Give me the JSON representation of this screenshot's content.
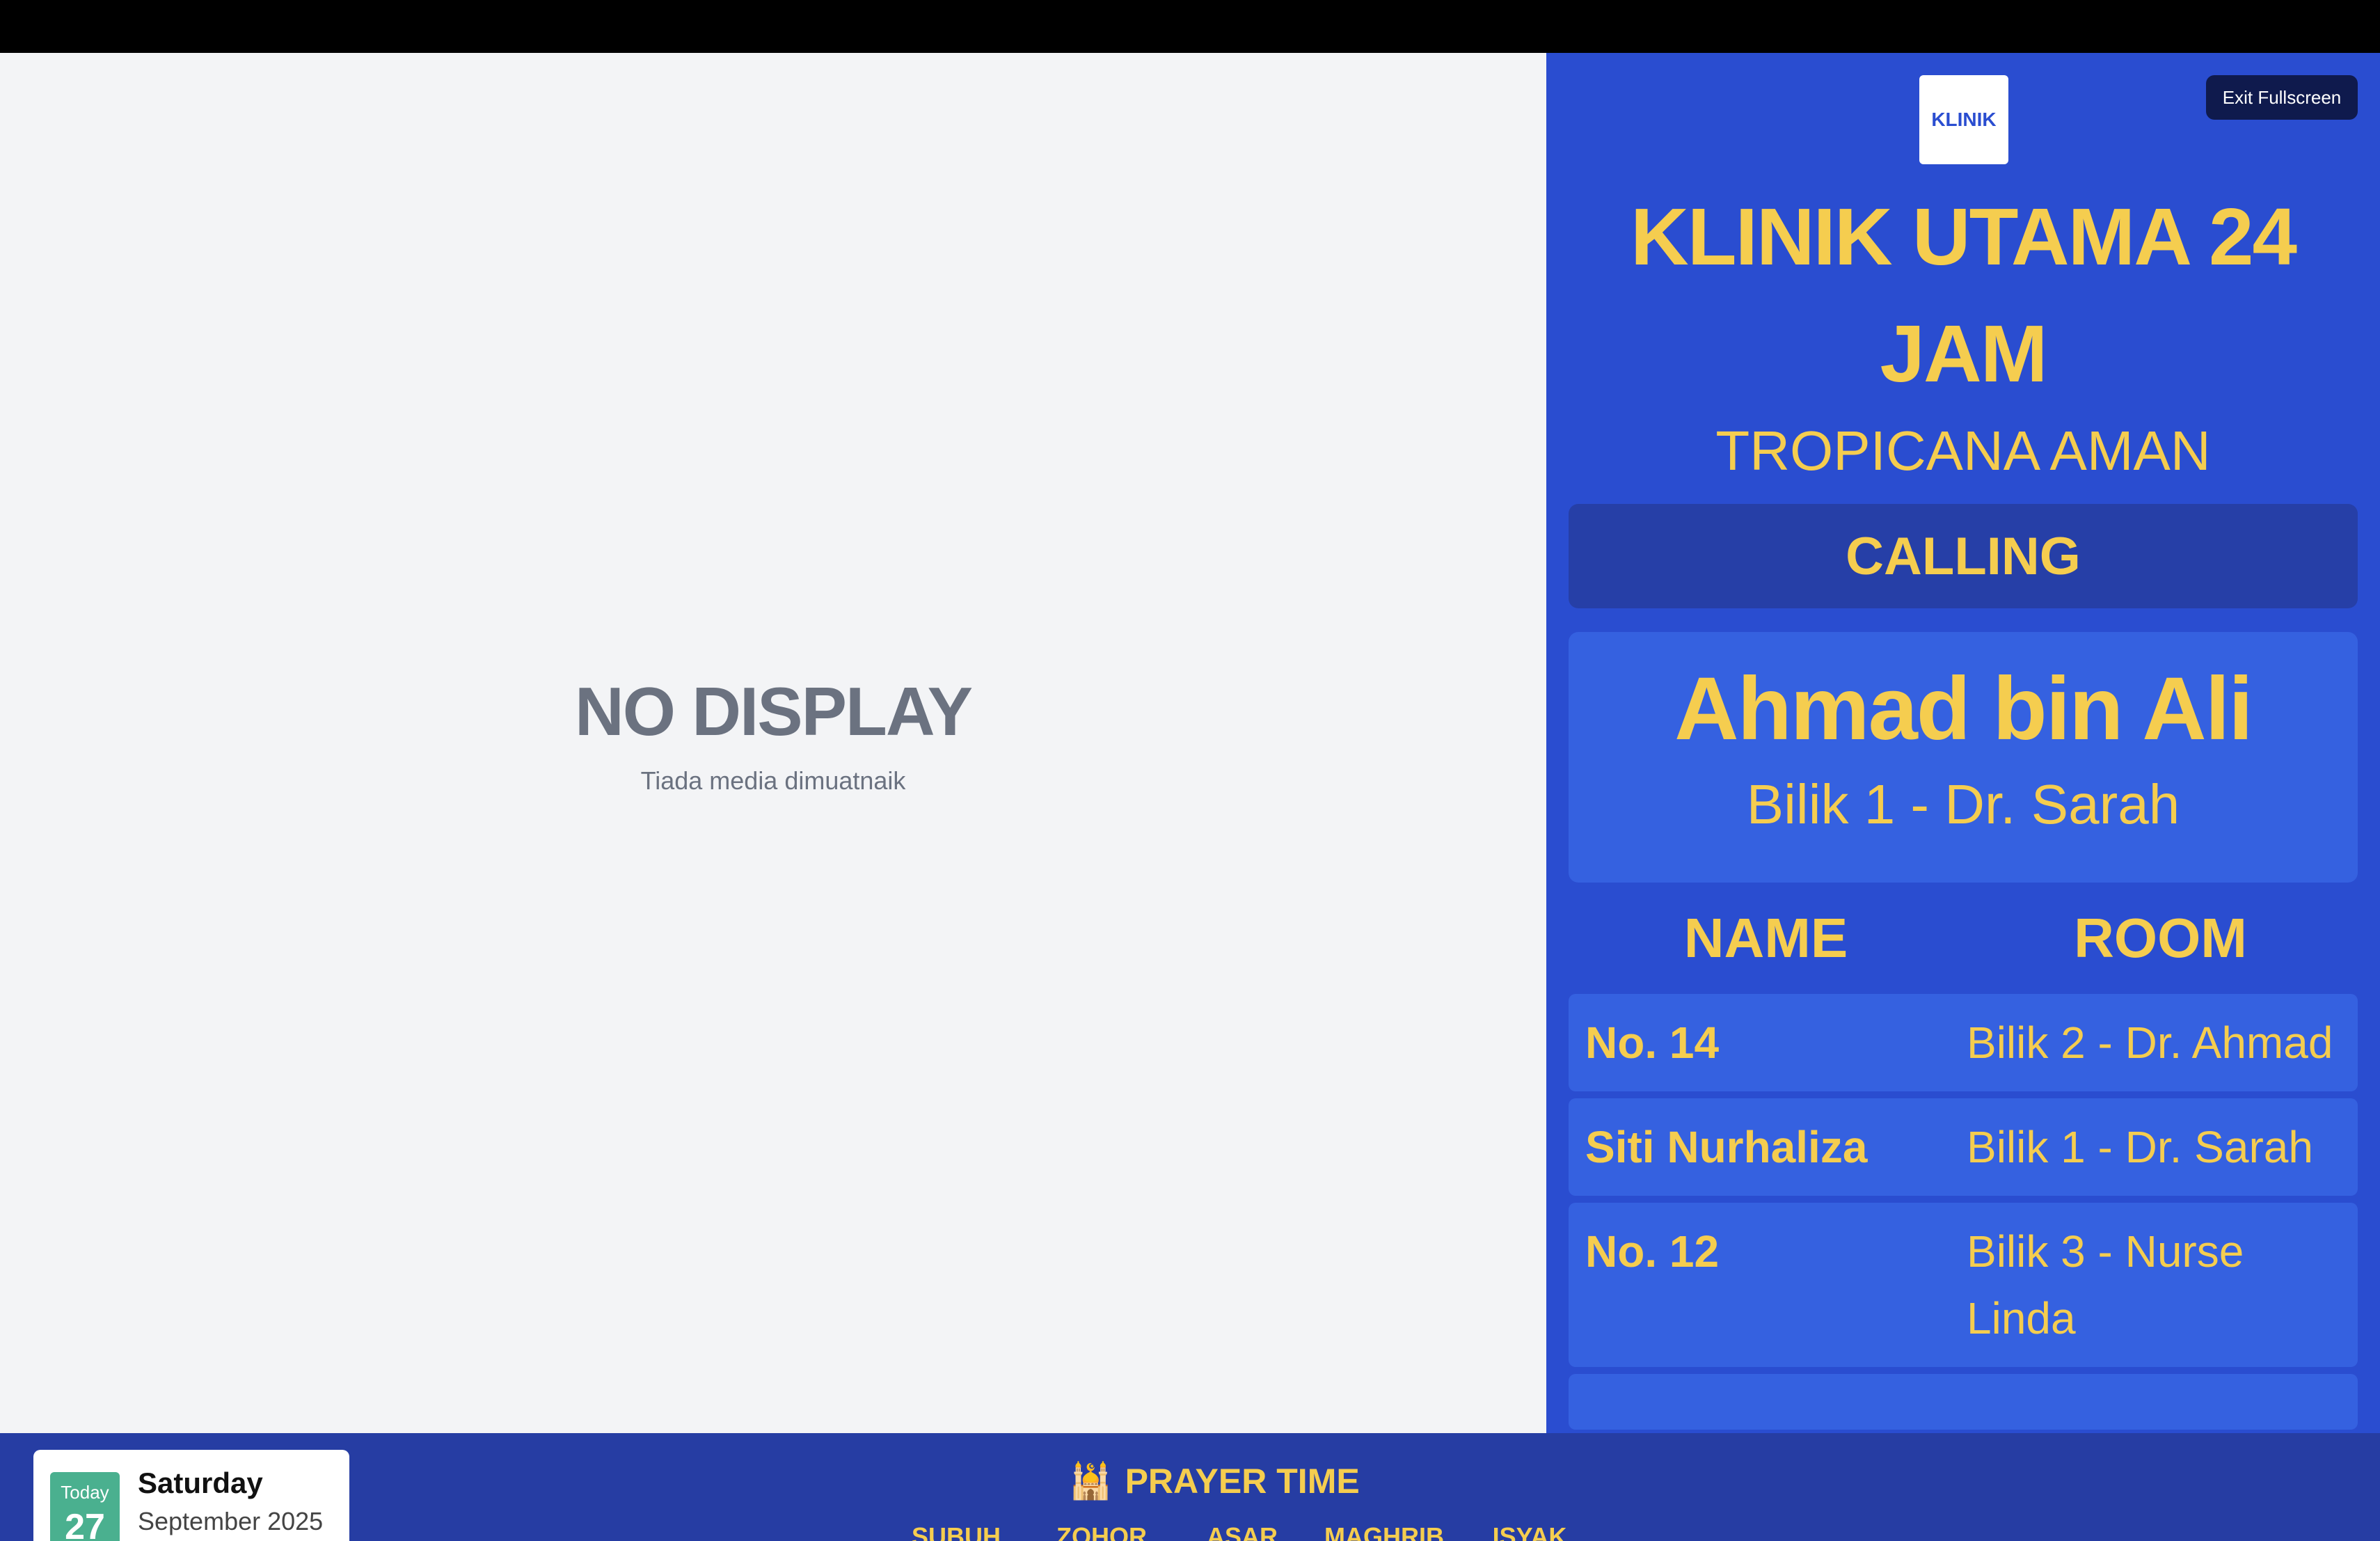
{
  "media": {
    "title": "NO DISPLAY",
    "subtitle": "Tiada media dimuatnaik"
  },
  "panel": {
    "logo_text": "KLINIK",
    "exit_label": "Exit Fullscreen",
    "clinic_name": "KLINIK UTAMA 24 JAM",
    "clinic_branch": "TROPICANA AMAN",
    "calling_label": "CALLING",
    "current": {
      "name": "Ahmad bin Ali",
      "room": "Bilik 1 - Dr. Sarah"
    },
    "headers": {
      "name": "NAME",
      "room": "ROOM"
    },
    "queue": [
      {
        "name": "No. 14",
        "room": "Bilik 2 - Dr. Ahmad"
      },
      {
        "name": "Siti Nurhaliza",
        "room": "Bilik 1 - Dr. Sarah"
      },
      {
        "name": "No. 12",
        "room": "Bilik 3 - Nurse Linda"
      }
    ]
  },
  "footer": {
    "today_label": "Today",
    "day_number": "27",
    "weekday": "Saturday",
    "month_year": "September 2025",
    "prayer_icon": "mosque-icon",
    "prayer_title": "PRAYER TIME",
    "prayers": [
      "SUBUH",
      "ZOHOR",
      "ASAR",
      "MAGHRIB",
      "ISYAK"
    ]
  },
  "colors": {
    "panel_bg": "#2a4dd0",
    "accent_yellow": "#f5cd4f",
    "calling_bg": "#263fa7",
    "card_bg": "#3561e0",
    "footer_bg": "#263da3",
    "date_badge": "#4ab08f"
  }
}
